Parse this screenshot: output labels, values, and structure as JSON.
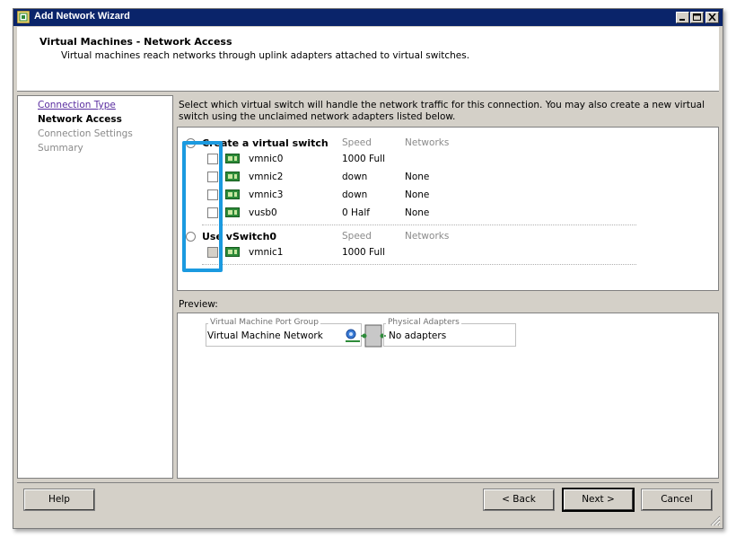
{
  "window": {
    "title": "Add Network Wizard"
  },
  "header": {
    "title": "Virtual Machines - Network Access",
    "subtitle": "Virtual machines reach networks through uplink adapters attached to virtual switches."
  },
  "nav": {
    "items": [
      {
        "label": "Connection Type",
        "state": "link"
      },
      {
        "label": "Network Access",
        "state": "current"
      },
      {
        "label": "Connection Settings",
        "state": "disabled"
      },
      {
        "label": "Summary",
        "state": "disabled"
      }
    ]
  },
  "instructions": "Select which virtual switch will handle the network traffic for this connection. You may also create a new virtual switch using the unclaimed network adapters listed below.",
  "switches": {
    "speed_header": "Speed",
    "networks_header": "Networks",
    "create": {
      "label": "Create a virtual switch",
      "selected": true,
      "adapters": [
        {
          "name": "vmnic0",
          "speed": "1000 Full",
          "networks": "",
          "checked": false
        },
        {
          "name": "vmnic2",
          "speed": "down",
          "networks": "None",
          "checked": false
        },
        {
          "name": "vmnic3",
          "speed": "down",
          "networks": "None",
          "checked": false
        },
        {
          "name": "vusb0",
          "speed": "0 Half",
          "networks": "None",
          "checked": false
        }
      ]
    },
    "existing": {
      "label": "Use vSwitch0",
      "selected": false,
      "adapters": [
        {
          "name": "vmnic1",
          "speed": "1000 Full",
          "networks": "",
          "checked": false,
          "disabled": true
        }
      ]
    }
  },
  "preview": {
    "label": "Preview:",
    "port_group_title": "Virtual Machine Port Group",
    "port_group_name": "Virtual Machine Network",
    "adapters_title": "Physical Adapters",
    "adapters_value": "No adapters"
  },
  "buttons": {
    "help": "Help",
    "back": "< Back",
    "next": "Next >",
    "cancel": "Cancel"
  },
  "colors": {
    "titlebar": "#0a246a",
    "highlight": "#1b9ae0",
    "nic_green": "#2e8b3a"
  }
}
